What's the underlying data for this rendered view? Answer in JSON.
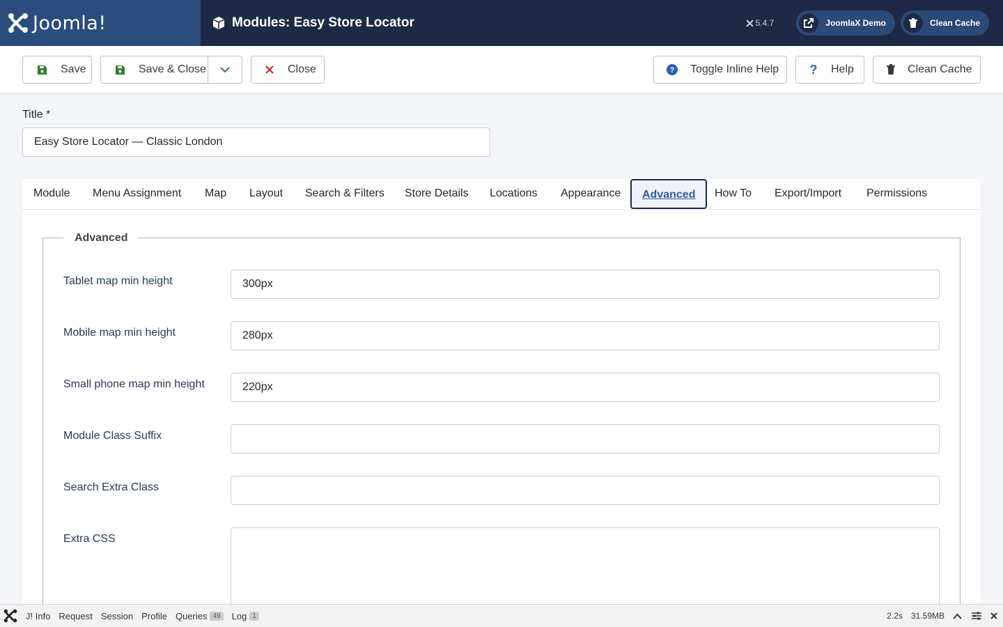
{
  "header": {
    "brand": "Joomla!",
    "page_title": "Modules: Easy Store Locator",
    "version": "5.4.7",
    "demo_button": "JoomlaX Demo",
    "clean_cache_button": "Clean Cache"
  },
  "toolbar": {
    "save": "Save",
    "save_close": "Save & Close",
    "close": "Close",
    "toggle_help": "Toggle Inline Help",
    "help": "Help",
    "clean_cache": "Clean Cache"
  },
  "title_field": {
    "label": "Title *",
    "value": "Easy Store Locator — Classic London"
  },
  "tabs": [
    "Module",
    "Menu Assignment",
    "Map",
    "Layout",
    "Search & Filters",
    "Store Details",
    "Locations",
    "Appearance",
    "Advanced",
    "How To",
    "Export/Import",
    "Permissions"
  ],
  "active_tab": "Advanced",
  "fieldset": {
    "legend": "Advanced",
    "fields": [
      {
        "label": "Tablet map min height",
        "value": "300px"
      },
      {
        "label": "Mobile map min height",
        "value": "280px"
      },
      {
        "label": "Small phone map min height",
        "value": "220px"
      },
      {
        "label": "Module Class Suffix",
        "value": ""
      },
      {
        "label": "Search Extra Class",
        "value": ""
      },
      {
        "label": "Extra CSS",
        "value": ""
      }
    ]
  },
  "debug_bar": {
    "items": [
      "J! Info",
      "Request",
      "Session",
      "Profile",
      "Queries",
      "Log"
    ],
    "queries_count": "49",
    "log_count": "1",
    "time": "2.2s",
    "memory": "31.59MB"
  },
  "colors": {
    "header_bg": "#1e2a45",
    "brand_bg": "#2a4d7d",
    "save_icon": "#2f7d32",
    "close_icon": "#c62828",
    "help_icon": "#2a5db0"
  }
}
